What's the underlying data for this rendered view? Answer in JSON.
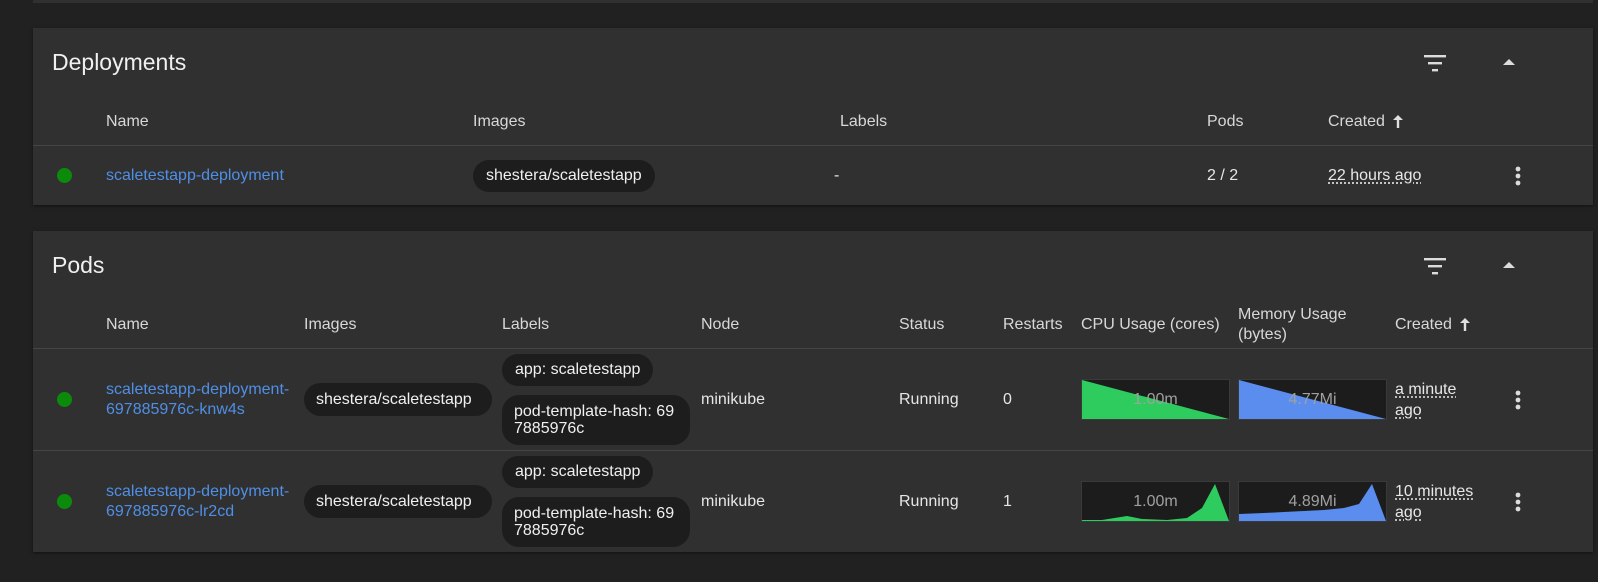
{
  "deployments": {
    "title": "Deployments",
    "columns": {
      "name": "Name",
      "images": "Images",
      "labels": "Labels",
      "pods": "Pods",
      "created": "Created"
    },
    "rows": [
      {
        "status_color": "#0c8a0c",
        "name": "scaletestapp-deployment",
        "image": "shestera/scaletestapp",
        "labels": "-",
        "pods": "2 / 2",
        "created": "22 hours ago"
      }
    ]
  },
  "pods": {
    "title": "Pods",
    "columns": {
      "name": "Name",
      "images": "Images",
      "labels": "Labels",
      "node": "Node",
      "status": "Status",
      "restarts": "Restarts",
      "cpu": "CPU Usage (cores)",
      "memory": "Memory Usage (bytes)",
      "created": "Created"
    },
    "rows": [
      {
        "status_color": "#0c8a0c",
        "name": "scaletestapp-deployment-697885976c-knw4s",
        "image": "shestera/scaletestapp",
        "label_app": "app: scaletestapp",
        "label_hash": "pod-template-hash: 697885976c",
        "node": "minikube",
        "status": "Running",
        "restarts": "0",
        "cpu_label": "1.00m",
        "mem_label": "4.77Mi",
        "created": "a minute ago"
      },
      {
        "status_color": "#0c8a0c",
        "name": "scaletestapp-deployment-697885976c-lr2cd",
        "image": "shestera/scaletestapp",
        "label_app": "app: scaletestapp",
        "label_hash": "pod-template-hash: 697885976c",
        "node": "minikube",
        "status": "Running",
        "restarts": "1",
        "cpu_label": "1.00m",
        "mem_label": "4.89Mi",
        "created": "10 minutes ago"
      }
    ]
  },
  "icons": {
    "filter": "filter-icon",
    "collapse": "chevron-up-icon",
    "more": "more-vertical-icon"
  },
  "colors": {
    "cpu_spark": "#2ecc5e",
    "memory_spark": "#5b8def",
    "link": "#4f8fe6",
    "running": "#0c8a0c"
  }
}
